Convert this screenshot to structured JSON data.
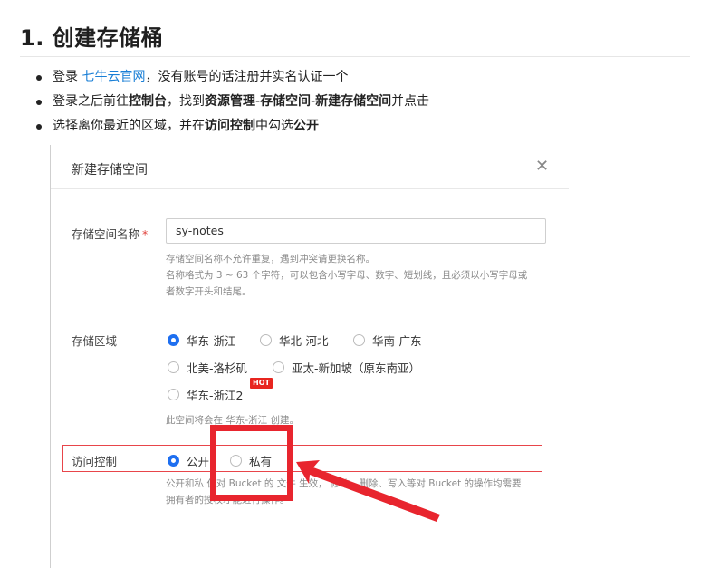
{
  "heading": "1. 创建存储桶",
  "steps": {
    "s1": {
      "prefix": "登录 ",
      "link": "七牛云官网",
      "suffix": "，没有账号的话注册并实名认证一个"
    },
    "s2": {
      "t1": "登录之后前往",
      "b1": "控制台",
      "t2": "，找到",
      "b2": "资源管理",
      "t3": "-",
      "b3": "存储空间",
      "t4": "-",
      "b4": "新建存储空间",
      "t5": "并点击"
    },
    "s3": {
      "t1": "选择离你最近的区域，并在",
      "b1": "访问控制",
      "t2": "中勾选",
      "b2": "公开"
    }
  },
  "dialog": {
    "title": "新建存储空间",
    "close_icon": "close-icon",
    "name_label": "存储空间名称",
    "required_mark": "*",
    "name_value": "sy-notes",
    "name_hint_1": "存储空间名称不允许重复，遇到冲突请更换名称。",
    "name_hint_2": "名称格式为 3 ~ 63 个字符，可以包含小写字母、数字、短划线，且必须以小写字母或",
    "name_hint_3": "者数字开头和结尾。",
    "region_label": "存储区域",
    "regions": [
      {
        "label": "华东-浙江",
        "selected": true
      },
      {
        "label": "华北-河北",
        "selected": false
      },
      {
        "label": "华南-广东",
        "selected": false
      },
      {
        "label": "北美-洛杉矶",
        "selected": false
      },
      {
        "label": "亚太-新加坡（原东南亚）",
        "selected": false
      },
      {
        "label": "华东-浙江2",
        "selected": false
      }
    ],
    "hot_badge": "HOT",
    "region_hint": "此空间将会在 华东-浙江 创建。",
    "access_label": "访问控制",
    "access_options": [
      {
        "label": "公开",
        "selected": true
      },
      {
        "label": "私有",
        "selected": false
      }
    ],
    "access_hint_1": "公开和私    仅对 Bucket 的    文件    生效，    修改、删除、写入等对 Bucket 的操作均需要",
    "access_hint_2": "拥有者的授权才能进行操作。"
  },
  "colors": {
    "link": "#1a7fd6",
    "radio_on": "#1e6ff0",
    "highlight": "#e8252e",
    "hot": "#e8251f"
  }
}
